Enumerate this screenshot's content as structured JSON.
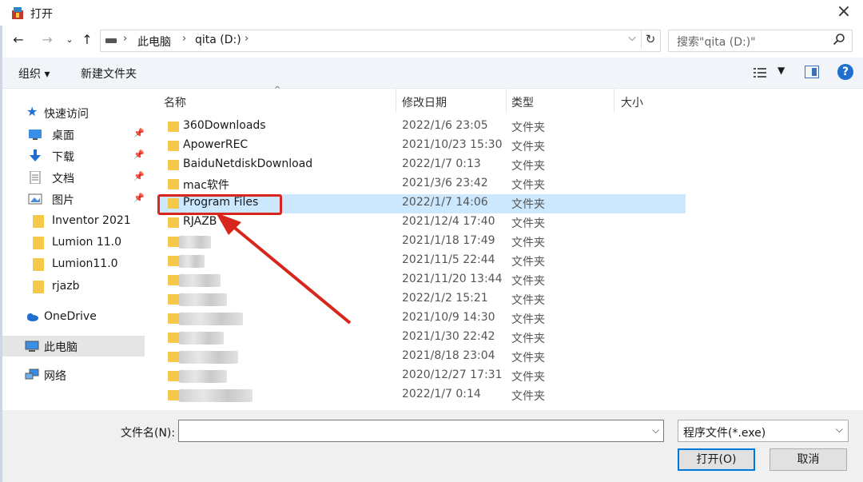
{
  "window": {
    "title": "打开",
    "close_glyph": "×"
  },
  "address": {
    "crumbs": [
      "此电脑",
      "qita (D:)"
    ],
    "search_placeholder": "搜索\"qita (D:)\""
  },
  "toolbar": {
    "organize": "组织 ▾",
    "new_folder": "新建文件夹"
  },
  "sidebar": {
    "quick_access": "快速访问",
    "pinned": [
      {
        "label": "桌面",
        "icon": "desktop-icon"
      },
      {
        "label": "下载",
        "icon": "download-icon"
      },
      {
        "label": "文档",
        "icon": "document-icon"
      },
      {
        "label": "图片",
        "icon": "picture-icon"
      }
    ],
    "folders": [
      "Inventor 2021",
      "Lumion 11.0",
      "Lumion11.0",
      "rjazb"
    ],
    "onedrive": "OneDrive",
    "this_pc": "此电脑",
    "network": "网络"
  },
  "columns": {
    "name": "名称",
    "modified": "修改日期",
    "type": "类型",
    "size": "大小"
  },
  "files": [
    {
      "name": "360Downloads",
      "date": "2022/1/6 23:05",
      "type": "文件夹"
    },
    {
      "name": "ApowerREC",
      "date": "2021/10/23 15:30",
      "type": "文件夹"
    },
    {
      "name": "BaiduNetdiskDownload",
      "date": "2022/1/7 0:13",
      "type": "文件夹"
    },
    {
      "name": "mac软件",
      "date": "2021/3/6 23:42",
      "type": "文件夹"
    },
    {
      "name": "Program Files",
      "date": "2022/1/7 14:06",
      "type": "文件夹",
      "selected": true
    },
    {
      "name": "RJAZB",
      "date": "2021/12/4 17:40",
      "type": "文件夹"
    },
    {
      "name": "",
      "date": "2021/1/18 17:49",
      "type": "文件夹"
    },
    {
      "name": "",
      "date": "2021/11/5 22:44",
      "type": "文件夹"
    },
    {
      "name": "",
      "date": "2021/11/20 13:44",
      "type": "文件夹"
    },
    {
      "name": "",
      "date": "2022/1/2 15:21",
      "type": "文件夹"
    },
    {
      "name": "",
      "date": "2021/10/9 14:30",
      "type": "文件夹"
    },
    {
      "name": "",
      "date": "2021/1/30 22:42",
      "type": "文件夹"
    },
    {
      "name": "",
      "date": "2021/8/18 23:04",
      "type": "文件夹"
    },
    {
      "name": "",
      "date": "2020/12/27 17:31",
      "type": "文件夹"
    },
    {
      "name": "",
      "date": "2022/1/7 0:14",
      "type": "文件夹"
    }
  ],
  "footer": {
    "filename_label": "文件名(N):",
    "filename_value": "",
    "filetype": "程序文件(*.exe)",
    "open": "打开(O)",
    "cancel": "取消"
  },
  "colors": {
    "selection": "#cce8ff",
    "highlight": "#d9261c",
    "folder": "#f5c84a"
  }
}
